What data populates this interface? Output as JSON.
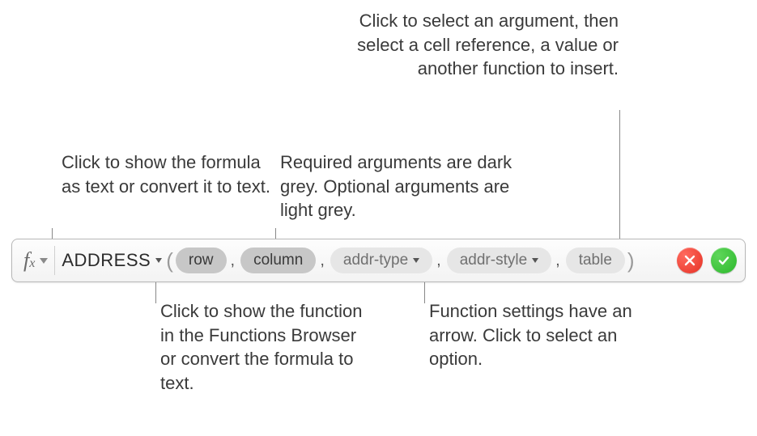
{
  "callouts": {
    "fx": "Click to show the formula as text or convert it to text.",
    "required": "Required arguments are dark grey. Optional arguments are light grey.",
    "insert": "Click to select an argument, then select a cell reference, a value or another function to insert.",
    "fnbrowser": "Click to show the function in the Functions Browser or convert the formula to text.",
    "settings": "Function settings have an arrow. Click to select an option."
  },
  "formula": {
    "fn_label": "ADDRESS",
    "args": {
      "row": "row",
      "column": "column",
      "addr_type": "addr-type",
      "addr_style": "addr-style",
      "table": "table"
    }
  }
}
